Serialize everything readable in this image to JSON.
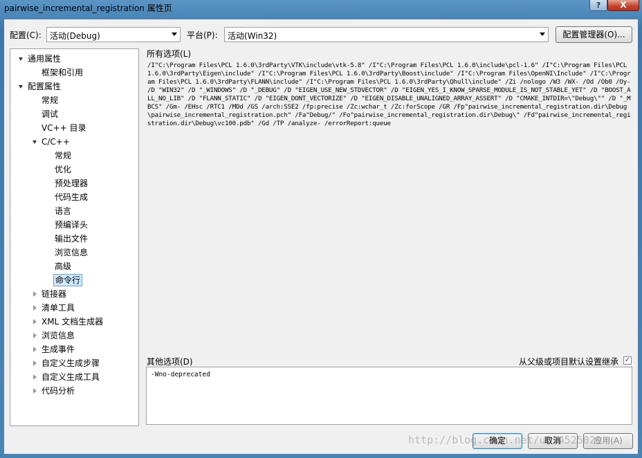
{
  "window": {
    "title": "pairwise_incremental_registration 属性页",
    "help_label": "?",
    "close_label": "X"
  },
  "config_bar": {
    "config_label": "配置(C):",
    "config_value": "活动(Debug)",
    "platform_label": "平台(P):",
    "platform_value": "活动(Win32)",
    "manager_button": "配置管理器(O)..."
  },
  "tree": {
    "items": [
      {
        "label": "通用属性",
        "level": 0,
        "expander": "open"
      },
      {
        "label": "框架和引用",
        "level": 1,
        "expander": "none"
      },
      {
        "label": "配置属性",
        "level": 0,
        "expander": "open"
      },
      {
        "label": "常规",
        "level": 1,
        "expander": "none"
      },
      {
        "label": "调试",
        "level": 1,
        "expander": "none"
      },
      {
        "label": "VC++ 目录",
        "level": 1,
        "expander": "none"
      },
      {
        "label": "C/C++",
        "level": 1,
        "expander": "open"
      },
      {
        "label": "常规",
        "level": 2,
        "expander": "none"
      },
      {
        "label": "优化",
        "level": 2,
        "expander": "none"
      },
      {
        "label": "预处理器",
        "level": 2,
        "expander": "none"
      },
      {
        "label": "代码生成",
        "level": 2,
        "expander": "none"
      },
      {
        "label": "语言",
        "level": 2,
        "expander": "none"
      },
      {
        "label": "预编译头",
        "level": 2,
        "expander": "none"
      },
      {
        "label": "输出文件",
        "level": 2,
        "expander": "none"
      },
      {
        "label": "浏览信息",
        "level": 2,
        "expander": "none"
      },
      {
        "label": "高级",
        "level": 2,
        "expander": "none"
      },
      {
        "label": "命令行",
        "level": 2,
        "expander": "none",
        "selected": true
      },
      {
        "label": "链接器",
        "level": 1,
        "expander": "closed"
      },
      {
        "label": "清单工具",
        "level": 1,
        "expander": "closed"
      },
      {
        "label": "XML 文档生成器",
        "level": 1,
        "expander": "closed"
      },
      {
        "label": "浏览信息",
        "level": 1,
        "expander": "closed"
      },
      {
        "label": "生成事件",
        "level": 1,
        "expander": "closed"
      },
      {
        "label": "自定义生成步骤",
        "level": 1,
        "expander": "closed"
      },
      {
        "label": "自定义生成工具",
        "level": 1,
        "expander": "closed"
      },
      {
        "label": "代码分析",
        "level": 1,
        "expander": "closed"
      }
    ]
  },
  "main": {
    "all_options_label": "所有选项(L)",
    "all_options_value": "/I\"C:\\Program Files\\PCL 1.6.0\\3rdParty\\VTK\\include\\vtk-5.8\" /I\"C:\\Program Files\\PCL 1.6.0\\include\\pcl-1.6\" /I\"C:\\Program Files\\PCL 1.6.0\\3rdParty\\Eigen\\include\" /I\"C:\\Program Files\\PCL 1.6.0\\3rdParty\\Boost\\include\" /I\"C:\\Program Files\\OpenNI\\Include\" /I\"C:\\Program Files\\PCL 1.6.0\\3rdParty\\FLANN\\include\" /I\"C:\\Program Files\\PCL 1.6.0\\3rdParty\\Qhull\\include\" /Zi /nologo /W3 /WX- /Od /Ob0 /Oy- /D \"WIN32\" /D \"_WINDOWS\" /D \"_DEBUG\" /D \"EIGEN_USE_NEW_STDVECTOR\" /D \"EIGEN_YES_I_KNOW_SPARSE_MODULE_IS_NOT_STABLE_YET\" /D \"BOOST_ALL_NO_LIB\" /D \"FLANN_STATIC\" /D \"EIGEN_DONT_VECTORIZE\" /D \"EIGEN_DISABLE_UNALIGNED_ARRAY_ASSERT\" /D \"CMAKE_INTDIR=\\\"Debug\\\"\" /D \"_MBCS\" /Gm- /EHsc /RTC1 /MDd /GS /arch:SSE2 /fp:precise /Zc:wchar_t /Zc:forScope /GR /Fp\"pairwise_incremental_registration.dir\\Debug\\pairwise_incremental_registration.pch\" /Fa\"Debug/\" /Fo\"pairwise_incremental_registration.dir\\Debug\\\" /Fd\"pairwise_incremental_registration.dir\\Debug\\vc100.pdb\" /Gd /TP /analyze- /errorReport:queue",
    "other_options_label": "其他选项(D)",
    "inherit_label": "从父级或项目默认设置继承",
    "inherit_checked": "✓",
    "other_options_value": "-Wno-deprecated"
  },
  "footer": {
    "ok_button": "确定",
    "cancel_button": "取消",
    "apply_button": "应用(A)",
    "watermark": "http://blog.csdn.net/u014525029"
  }
}
